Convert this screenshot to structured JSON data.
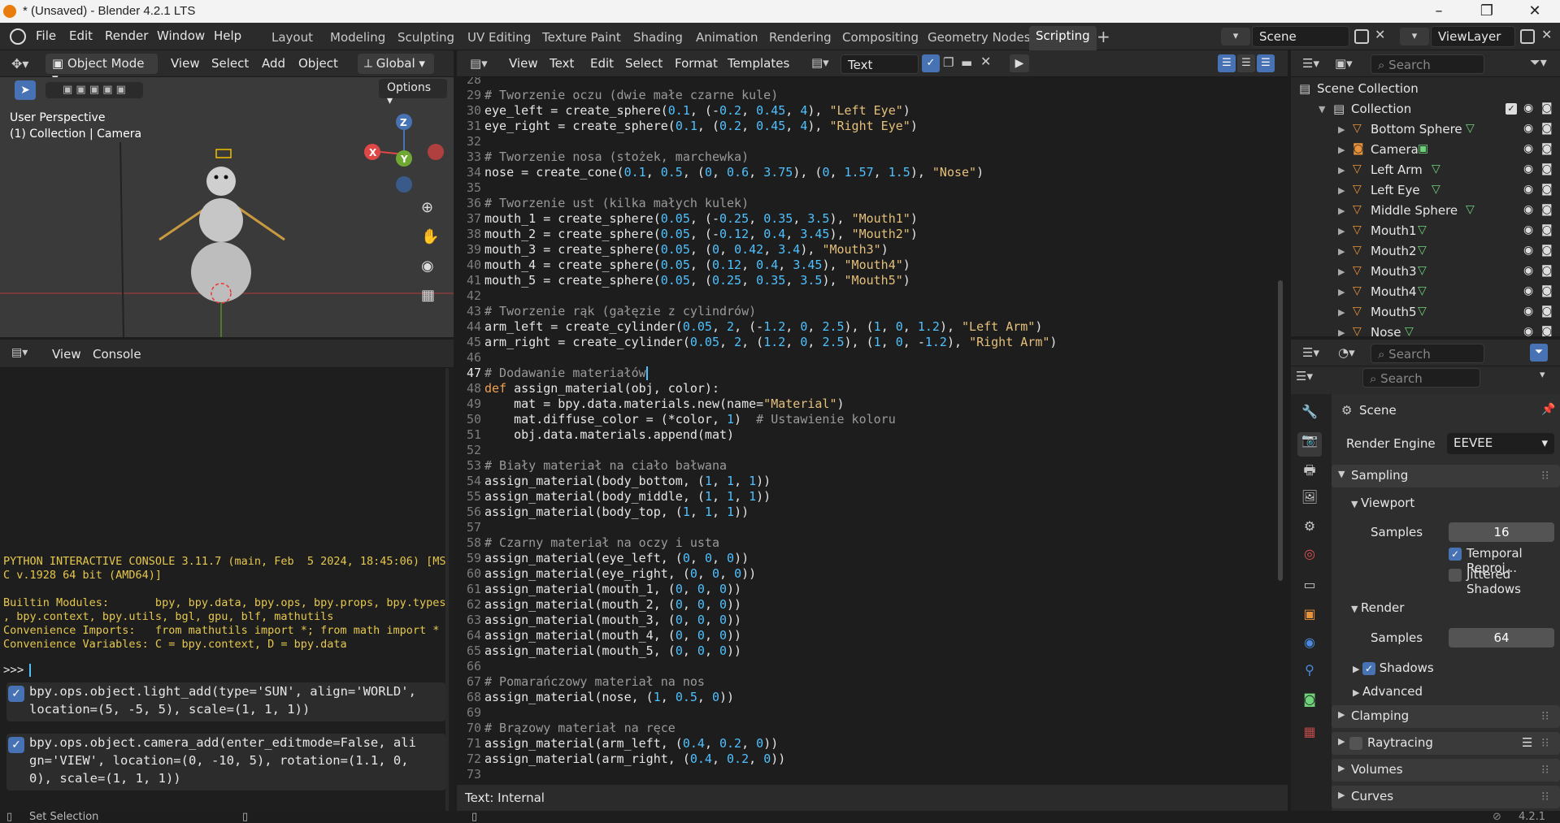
{
  "window": {
    "title": "* (Unsaved) - Blender 4.2.1 LTS"
  },
  "menubar": {
    "items": [
      "File",
      "Edit",
      "Render",
      "Window",
      "Help"
    ],
    "workspaces": [
      "Layout",
      "Modeling",
      "Sculpting",
      "UV Editing",
      "Texture Paint",
      "Shading",
      "Animation",
      "Rendering",
      "Compositing",
      "Geometry Nodes",
      "Scripting"
    ],
    "active_workspace": "Scripting",
    "scene": "Scene",
    "view_layer": "ViewLayer"
  },
  "viewport": {
    "mode": "Object Mode",
    "menus": [
      "View",
      "Select",
      "Add",
      "Object"
    ],
    "transform_orientation": "Global",
    "options_label": "Options",
    "perspective": "User Perspective",
    "collection_info": "(1) Collection | Camera",
    "gizmo": {
      "x": "X",
      "y": "Y",
      "z": "Z"
    }
  },
  "console": {
    "menus": [
      "View",
      "Console"
    ],
    "lines": [
      "PYTHON INTERACTIVE CONSOLE 3.11.7 (main, Feb  5 2024, 18:45:06) [MS",
      "C v.1928 64 bit (AMD64)]",
      "",
      "Builtin Modules:       bpy, bpy.data, bpy.ops, bpy.props, bpy.types",
      ", bpy.context, bpy.utils, bgl, gpu, blf, mathutils",
      "Convenience Imports:   from mathutils import *; from math import *",
      "Convenience Variables: C = bpy.context, D = bpy.data"
    ],
    "prompt": ">>> ",
    "reports": [
      {
        "line1": "bpy.ops.object.light_add(type='SUN', align='WORLD',",
        "line2": "location=(5, -5, 5), scale=(1, 1, 1))"
      },
      {
        "line1": "bpy.ops.object.camera_add(enter_editmode=False, ali",
        "line2": "gn='VIEW', location=(0, -10, 5), rotation=(1.1, 0,",
        "line3": "0), scale=(1, 1, 1))"
      }
    ]
  },
  "editor": {
    "menus": [
      "View",
      "Text",
      "Edit",
      "Select",
      "Format",
      "Templates"
    ],
    "text_name": "Text",
    "footer": "Text: Internal",
    "first_line": 28,
    "current_line": 47,
    "lines": [
      "",
      "# Tworzenie oczu (dwie małe czarne kule)",
      "eye_left = create_sphere(0.1, (-0.2, 0.45, 4), \"Left Eye\")",
      "eye_right = create_sphere(0.1, (0.2, 0.45, 4), \"Right Eye\")",
      "",
      "# Tworzenie nosa (stożek, marchewka)",
      "nose = create_cone(0.1, 0.5, (0, 0.6, 3.75), (0, 1.57, 1.5), \"Nose\")",
      "",
      "# Tworzenie ust (kilka małych kulek)",
      "mouth_1 = create_sphere(0.05, (-0.25, 0.35, 3.5), \"Mouth1\")",
      "mouth_2 = create_sphere(0.05, (-0.12, 0.4, 3.45), \"Mouth2\")",
      "mouth_3 = create_sphere(0.05, (0, 0.42, 3.4), \"Mouth3\")",
      "mouth_4 = create_sphere(0.05, (0.12, 0.4, 3.45), \"Mouth4\")",
      "mouth_5 = create_sphere(0.05, (0.25, 0.35, 3.5), \"Mouth5\")",
      "",
      "# Tworzenie rąk (gałęzie z cylindrów)",
      "arm_left = create_cylinder(0.05, 2, (-1.2, 0, 2.5), (1, 0, 1.2), \"Left Arm\")",
      "arm_right = create_cylinder(0.05, 2, (1.2, 0, 2.5), (1, 0, -1.2), \"Right Arm\")",
      "",
      "# Dodawanie materiałów",
      "def assign_material(obj, color):",
      "    mat = bpy.data.materials.new(name=\"Material\")",
      "    mat.diffuse_color = (*color, 1)  # Ustawienie koloru",
      "    obj.data.materials.append(mat)",
      "",
      "# Biały materiał na ciało bałwana",
      "assign_material(body_bottom, (1, 1, 1))",
      "assign_material(body_middle, (1, 1, 1))",
      "assign_material(body_top, (1, 1, 1))",
      "",
      "# Czarny materiał na oczy i usta",
      "assign_material(eye_left, (0, 0, 0))",
      "assign_material(eye_right, (0, 0, 0))",
      "assign_material(mouth_1, (0, 0, 0))",
      "assign_material(mouth_2, (0, 0, 0))",
      "assign_material(mouth_3, (0, 0, 0))",
      "assign_material(mouth_4, (0, 0, 0))",
      "assign_material(mouth_5, (0, 0, 0))",
      "",
      "# Pomarańczowy materiał na nos",
      "assign_material(nose, (1, 0.5, 0))",
      "",
      "# Brązowy materiał na ręce",
      "assign_material(arm_left, (0.4, 0.2, 0))",
      "assign_material(arm_right, (0.4, 0.2, 0))",
      ""
    ]
  },
  "outliner": {
    "search_placeholder": "Search",
    "scene_collection": "Scene Collection",
    "collection": "Collection",
    "items": [
      "Bottom Sphere",
      "Camera",
      "Left Arm",
      "Left Eye",
      "Middle Sphere",
      "Mouth1",
      "Mouth2",
      "Mouth3",
      "Mouth4",
      "Mouth5",
      "Nose"
    ]
  },
  "properties": {
    "search_placeholder": "Search",
    "context": "Scene",
    "render_engine_label": "Render Engine",
    "render_engine": "EEVEE",
    "sampling": "Sampling",
    "viewport_section": "Viewport",
    "viewport_samples_label": "Samples",
    "viewport_samples": "16",
    "temporal_reprojection": "Temporal Reproj...",
    "jittered_shadows": "Jittered Shadows",
    "render_section": "Render",
    "render_samples_label": "Samples",
    "render_samples": "64",
    "shadows": "Shadows",
    "advanced": "Advanced",
    "clamping": "Clamping",
    "raytracing": "Raytracing",
    "volumes": "Volumes",
    "curves": "Curves"
  },
  "status": {
    "left": "Set Selection",
    "version": "4.2.1"
  },
  "colors": {
    "accent_blue": "#4772b3",
    "mesh_orange": "#e8923a",
    "data_green": "#6fd27a"
  }
}
